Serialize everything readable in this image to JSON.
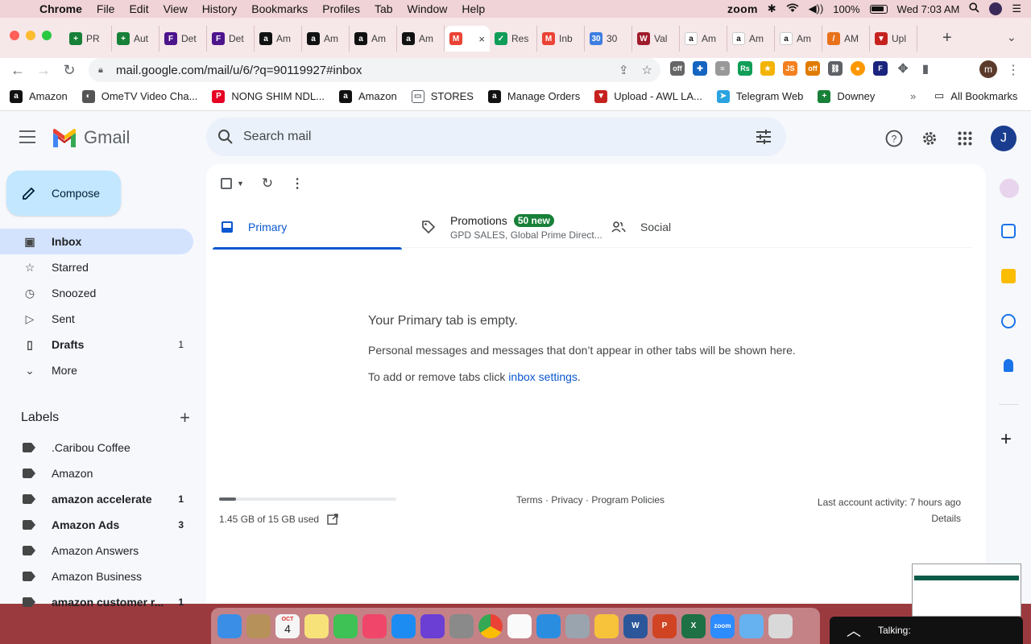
{
  "menubar": {
    "app_name": "Chrome",
    "items": [
      "File",
      "Edit",
      "View",
      "History",
      "Bookmarks",
      "Profiles",
      "Tab",
      "Window",
      "Help"
    ],
    "zoom_label": "zoom",
    "battery": "100%",
    "clock": "Wed 7:03 AM"
  },
  "tabs": [
    {
      "title": "PR",
      "icon": "sheets-icon",
      "color": "#188038",
      "glyph": "+"
    },
    {
      "title": "Aut",
      "icon": "sheets-icon",
      "color": "#188038",
      "glyph": "+"
    },
    {
      "title": "Det",
      "icon": "fedex-icon",
      "color": "#4d148c",
      "glyph": "F"
    },
    {
      "title": "Det",
      "icon": "fedex-icon",
      "color": "#4d148c",
      "glyph": "F"
    },
    {
      "title": "Am",
      "icon": "amazon-icon",
      "color": "#111111",
      "glyph": "a"
    },
    {
      "title": "Am",
      "icon": "amazon-icon",
      "color": "#111111",
      "glyph": "a"
    },
    {
      "title": "Am",
      "icon": "amazon-icon",
      "color": "#111111",
      "glyph": "a"
    },
    {
      "title": "Am",
      "icon": "amazon-icon",
      "color": "#111111",
      "glyph": "a"
    },
    {
      "title": "",
      "icon": "gmail-icon",
      "color": "#ea4335",
      "glyph": "M",
      "active": true
    },
    {
      "title": "Res",
      "icon": "green-check-icon",
      "color": "#0f9d58",
      "glyph": "✓"
    },
    {
      "title": "Inb",
      "icon": "gmail-icon",
      "color": "#ea4335",
      "glyph": "M"
    },
    {
      "title": "30",
      "icon": "thirty-icon",
      "color": "#3d7ee0",
      "glyph": "30"
    },
    {
      "title": "Val",
      "icon": "vw-icon",
      "color": "#a01c2c",
      "glyph": "W"
    },
    {
      "title": "Am",
      "icon": "amazon-icon",
      "color": "#ffffff",
      "glyph": "a"
    },
    {
      "title": "Am",
      "icon": "amazon-icon",
      "color": "#ffffff",
      "glyph": "a"
    },
    {
      "title": "Am",
      "icon": "amazon-icon",
      "color": "#ffffff",
      "glyph": "a"
    },
    {
      "title": "AM",
      "icon": "pencil-icon",
      "color": "#e8711a",
      "glyph": "/"
    },
    {
      "title": "Upl",
      "icon": "upload-icon",
      "color": "#c5221f",
      "glyph": "▼"
    }
  ],
  "browser": {
    "url": "mail.google.com/mail/u/6/?q=90119927#inbox",
    "profile_initial": "m"
  },
  "bookmarks": [
    {
      "label": "Amazon",
      "icon": "amazon-icon",
      "color": "#111111",
      "glyph": "a"
    },
    {
      "label": "OmeTV Video Cha...",
      "icon": "globe-icon",
      "color": "#555555",
      "glyph": "◐"
    },
    {
      "label": "NONG SHIM NDL...",
      "icon": "pinterest-icon",
      "color": "#e60023",
      "glyph": "P"
    },
    {
      "label": "Amazon",
      "icon": "amazon-icon",
      "color": "#111111",
      "glyph": "a"
    },
    {
      "label": "STORES",
      "icon": "folder-icon",
      "color": "#ffffff",
      "glyph": "▭"
    },
    {
      "label": "Manage Orders",
      "icon": "amazon-icon",
      "color": "#111111",
      "glyph": "a"
    },
    {
      "label": "Upload - AWL LA...",
      "icon": "upload-icon",
      "color": "#c5221f",
      "glyph": "▼"
    },
    {
      "label": "Telegram Web",
      "icon": "telegram-icon",
      "color": "#2aa3e0",
      "glyph": "➤"
    },
    {
      "label": "Downey",
      "icon": "sheets-icon",
      "color": "#188038",
      "glyph": "+"
    }
  ],
  "bookmarks_more": "»",
  "bookmarks_all": "All Bookmarks",
  "gmail": {
    "logo_text": "Gmail",
    "search_placeholder": "Search mail",
    "account_initial": "J",
    "compose": "Compose",
    "nav": [
      {
        "label": "Inbox",
        "icon": "inbox-icon",
        "glyph": "▣",
        "active": true
      },
      {
        "label": "Starred",
        "icon": "star-icon",
        "glyph": "☆"
      },
      {
        "label": "Snoozed",
        "icon": "clock-icon",
        "glyph": "◷"
      },
      {
        "label": "Sent",
        "icon": "send-icon",
        "glyph": "▷"
      },
      {
        "label": "Drafts",
        "icon": "draft-icon",
        "glyph": "▯",
        "count": "1",
        "bold": true
      },
      {
        "label": "More",
        "icon": "chevron-down-icon",
        "glyph": "⌄"
      }
    ],
    "labels_title": "Labels",
    "labels": [
      {
        "label": ".Caribou Coffee"
      },
      {
        "label": "Amazon"
      },
      {
        "label": "amazon accelerate",
        "count": "1",
        "bold": true
      },
      {
        "label": "Amazon Ads",
        "count": "3",
        "bold": true
      },
      {
        "label": "Amazon Answers"
      },
      {
        "label": "Amazon Business"
      },
      {
        "label": "amazon customer r...",
        "count": "1",
        "bold": true
      }
    ],
    "inbox_tabs": {
      "primary": "Primary",
      "promotions": "Promotions",
      "promotions_badge": "50 new",
      "promotions_snippet": "GPD SALES, Global Prime Direct...",
      "social": "Social"
    },
    "empty": {
      "title": "Your Primary tab is empty.",
      "desc": "Personal messages and messages that don’t appear in other tabs will be shown here.",
      "settings_prefix": "To add or remove tabs click ",
      "settings_link": "inbox settings",
      "settings_suffix": "."
    },
    "footer": {
      "storage": "1.45 GB of 15 GB used",
      "storage_fraction": 0.097,
      "links": "Terms · Privacy · Program Policies",
      "activity": "Last account activity: 7 hours ago",
      "details": "Details"
    }
  },
  "dock": [
    {
      "icon": "finder-icon",
      "color": "#3a8ee6"
    },
    {
      "icon": "contacts-icon",
      "color": "#b7915a"
    },
    {
      "icon": "calendar-icon",
      "color": "#f5f5f5"
    },
    {
      "icon": "notes-icon",
      "color": "#f7e27a"
    },
    {
      "icon": "facetime-icon",
      "color": "#3ec155"
    },
    {
      "icon": "music-icon",
      "color": "#f0466a"
    },
    {
      "icon": "app-store-icon",
      "color": "#1d8cf2"
    },
    {
      "icon": "siri-icon",
      "color": "#6b3fd4"
    },
    {
      "icon": "system-preferences-icon",
      "color": "#8a8a8a"
    },
    {
      "icon": "chrome-icon",
      "color": "#e8453c"
    },
    {
      "icon": "reminders-icon",
      "color": "#fafafa"
    },
    {
      "icon": "safari-icon",
      "color": "#2b8de0"
    },
    {
      "icon": "launchpad-icon",
      "color": "#9aa4ae"
    },
    {
      "icon": "photos-icon",
      "color": "#f7c33b"
    },
    {
      "icon": "word-icon",
      "color": "#2b579a"
    },
    {
      "icon": "powerpoint-icon",
      "color": "#d04423"
    },
    {
      "icon": "excel-icon",
      "color": "#1e7145"
    },
    {
      "icon": "zoom-icon",
      "color": "#2d8cff"
    },
    {
      "icon": "folder-icon",
      "color": "#66b2f0"
    },
    {
      "icon": "trash-icon",
      "color": "#d9d9d9"
    }
  ],
  "calendar_date": "4",
  "calendar_month": "OCT",
  "zoom_text": "zoom",
  "talking_label": "Talking:"
}
